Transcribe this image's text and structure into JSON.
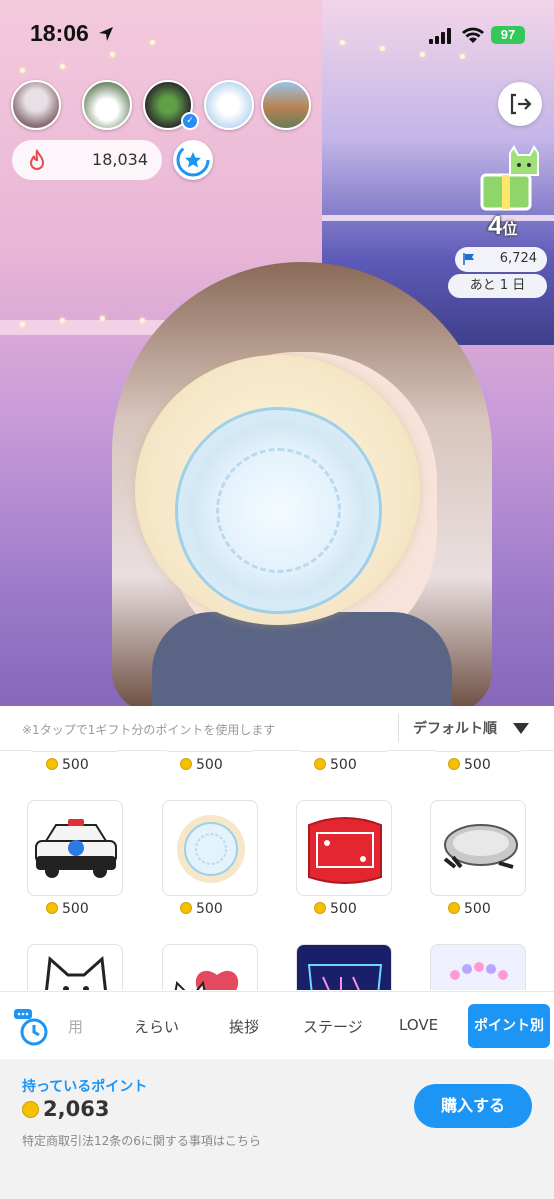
{
  "status_bar": {
    "time": "18:06",
    "battery": "97"
  },
  "stream": {
    "points_value": "18,034",
    "rank_number": "4",
    "rank_suffix": "位",
    "flag_value": "6,724",
    "days_remaining": "あと 1 日"
  },
  "gift_panel": {
    "info_text": "※1タップで1ギフト分のポイントを使用します",
    "sort_label": "デフォルト順",
    "row_partial_costs": [
      "500",
      "500",
      "500",
      "500"
    ],
    "row2_costs": [
      "500",
      "500",
      "500",
      "500"
    ]
  },
  "tabs": {
    "items": [
      "用",
      "えらい",
      "挨拶",
      "ステージ",
      "LOVE"
    ],
    "active": "ポイント別"
  },
  "footer": {
    "have_label": "持っているポイント",
    "have_value": "2,063",
    "legal_link": "特定商取引法12条の6に関する事項はこちら",
    "buy_label": "購入する"
  },
  "colors": {
    "accent": "#1c95f5",
    "coin": "#f5c000"
  }
}
